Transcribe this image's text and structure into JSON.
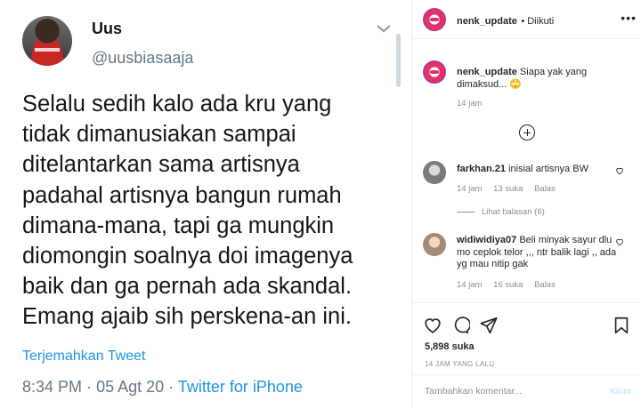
{
  "tweet": {
    "name": "Uus",
    "handle": "@uusbiasaaja",
    "lines": [
      "Selalu sedih kalo ada kru yang",
      "tidak dimanusiakan sampai",
      "ditelantarkan sama artisnya",
      "padahal artisnya bangun rumah",
      "dimana-mana, tapi ga mungkin",
      "diomongin soalnya doi imagenya",
      "baik dan ga pernah ada skandal.",
      "Emang ajaib sih perskena-an ini."
    ],
    "translate": "Terjemahkan Tweet",
    "time": "8:34 PM",
    "date": "05 Agt 20",
    "source": "Twitter for iPhone"
  },
  "instagram": {
    "header": {
      "username": "nenk_update",
      "follow_status": "Diikuti"
    },
    "caption": {
      "username": "nenk_update",
      "text": "Siapa yak yang dimaksud... 🙄",
      "time": "14 jam"
    },
    "comments": [
      {
        "username": "farkhan.21",
        "text": "inisial artisnya BW",
        "time": "14 jam",
        "likes": "13 suka",
        "reply": "Balas"
      },
      {
        "username": "widiwidiya07",
        "text": "Beli minyak sayur dlu mo ceplok telor ,,, ntr balik lagi ,, ada yg mau nitip gak",
        "time": "14 jam",
        "likes": "16 suka",
        "reply": "Balas"
      }
    ],
    "view_replies": "Lihat balasan (6)",
    "likes": "5,898 suka",
    "posted_ago": "14 JAM YANG LALU",
    "comment_placeholder": "Tambahkan komentar...",
    "post_label": "Kirim"
  },
  "colors": {
    "twitter_blue": "#1b95e0",
    "ig_link_disabled": "#b2dffc"
  }
}
